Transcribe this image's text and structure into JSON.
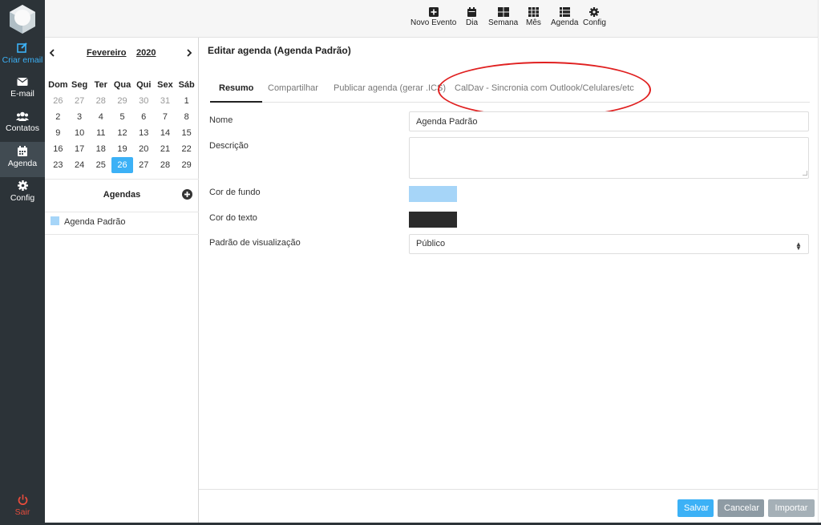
{
  "nav": {
    "compose_label": "Criar email",
    "email_label": "E-mail",
    "contacts_label": "Contatos",
    "agenda_label": "Agenda",
    "config_label": "Config",
    "logout_label": "Sair"
  },
  "calendar": {
    "month": "Fevereiro",
    "year": "2020",
    "weekdays": [
      "Dom",
      "Seg",
      "Ter",
      "Qua",
      "Qui",
      "Sex",
      "Sáb"
    ],
    "weeks": [
      [
        "26",
        "27",
        "28",
        "29",
        "30",
        "31",
        "1"
      ],
      [
        "2",
        "3",
        "4",
        "5",
        "6",
        "7",
        "8"
      ],
      [
        "9",
        "10",
        "11",
        "12",
        "13",
        "14",
        "15"
      ],
      [
        "16",
        "17",
        "18",
        "19",
        "20",
        "21",
        "22"
      ],
      [
        "23",
        "24",
        "25",
        "26",
        "27",
        "28",
        "29"
      ]
    ],
    "today": "26"
  },
  "agendas": {
    "title": "Agendas",
    "items": [
      {
        "label": "Agenda Padrão",
        "color": "#a6d5f8"
      }
    ]
  },
  "toolbar": {
    "new_event": "Novo Evento",
    "day": "Dia",
    "week": "Semana",
    "month": "Mês",
    "agenda": "Agenda",
    "config": "Config"
  },
  "main": {
    "title": "Editar agenda (Agenda Padrão)",
    "tabs": [
      {
        "label": "Resumo",
        "active": true
      },
      {
        "label": "Compartilhar"
      },
      {
        "label": "Publicar agenda (gerar .ICS)"
      },
      {
        "label": "CalDav - Sincronia com Outlook/Celulares/etc"
      }
    ],
    "form": {
      "name_label": "Nome",
      "name_value": "Agenda Padrão",
      "desc_label": "Descrição",
      "desc_value": "",
      "bg_label": "Cor de fundo",
      "bg_color": "#a6d5f8",
      "text_label": "Cor do texto",
      "text_color": "#2b2b2b",
      "view_label": "Padrão de visualização",
      "view_value": "Público"
    }
  },
  "footer": {
    "save": "Salvar",
    "cancel": "Cancelar",
    "import": "Importar"
  },
  "colors": {
    "accent": "#3cb1f6",
    "sidebar": "#2c3338",
    "annotation": "#e02020"
  }
}
